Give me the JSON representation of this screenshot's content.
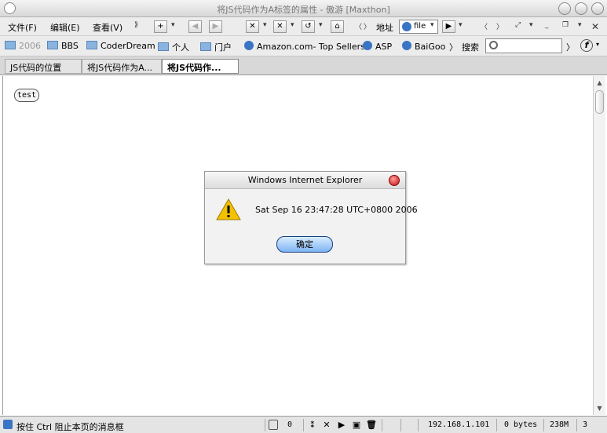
{
  "window": {
    "title": "将JS代码作为A标签的属性 - 傲游 [Maxthon]"
  },
  "menu": {
    "file": "文件(F)",
    "edit": "编辑(E)",
    "view": "查看(V)"
  },
  "address": {
    "label": "地址",
    "value": "file"
  },
  "favorites": [
    {
      "label": "2006",
      "icon": "folder"
    },
    {
      "label": "BBS",
      "icon": "folder"
    },
    {
      "label": "CoderDream",
      "icon": "folder"
    },
    {
      "label": "个人",
      "icon": "folder"
    },
    {
      "label": "门户",
      "icon": "folder"
    },
    {
      "label": "Amazon.com- Top Sellers",
      "icon": "ie"
    },
    {
      "label": "ASP",
      "icon": "ie"
    },
    {
      "label": "BaiGoo",
      "icon": "ie"
    }
  ],
  "search": {
    "label": "搜索",
    "value": ""
  },
  "tabs": [
    {
      "label": "JS代码的位置"
    },
    {
      "label": "将JS代码作为A..."
    },
    {
      "label": "将JS代码作..."
    }
  ],
  "page": {
    "button_label": "test"
  },
  "dialog": {
    "title": "Windows Internet Explorer",
    "message": "Sat Sep 16 23:47:28 UTC+0800 2006",
    "ok_label": "确定"
  },
  "status": {
    "hint": "按住 Ctrl 阻止本页的消息框",
    "popup_count": "0",
    "ip": "192.168.1.101",
    "bytes": "0 bytes",
    "memory": "238M",
    "count": "3"
  },
  "colors": {
    "dialog_button": "#7fb4f4",
    "close_button": "#c41010",
    "warning": "#f2c200"
  }
}
